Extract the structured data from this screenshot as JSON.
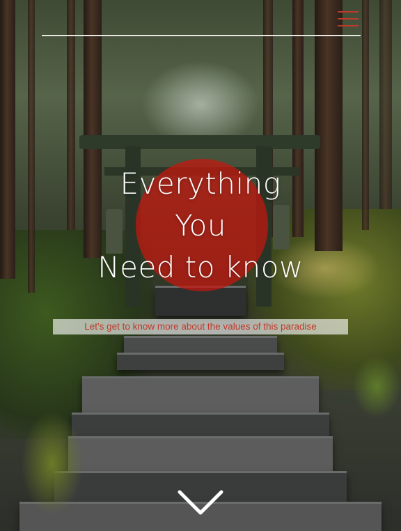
{
  "header": {
    "menu_icon": "hamburger-menu-icon",
    "menu_color": "#c1392b"
  },
  "hero": {
    "title_lines": [
      "Everything",
      "You",
      "Need to know"
    ],
    "tagline": "Let's get to know more about the values of this paradise",
    "accent_color": "#c8160e",
    "scroll_icon": "chevron-down-icon"
  }
}
